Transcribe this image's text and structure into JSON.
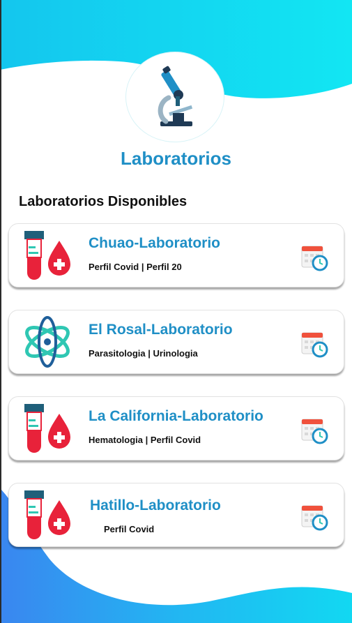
{
  "header": {
    "title": "Laboratorios",
    "logo_icon": "microscope-icon"
  },
  "section": {
    "title": "Laboratorios Disponibles"
  },
  "labs": [
    {
      "name": "Chuao-Laboratorio",
      "tags": "Perfil Covid | Perfil 20",
      "icon": "blood-test-icon",
      "action_icon": "calendar-clock-icon"
    },
    {
      "name": "El Rosal-Laboratorio",
      "tags": "Parasitologia | Urinologia",
      "icon": "atom-icon",
      "action_icon": "calendar-clock-icon"
    },
    {
      "name": "La California-Laboratorio",
      "tags": "Hematologia | Perfil Covid",
      "icon": "blood-test-icon",
      "action_icon": "calendar-clock-icon"
    },
    {
      "name": "Hatillo-Laboratorio",
      "tags": "Perfil Covid",
      "icon": "blood-test-icon",
      "action_icon": "calendar-clock-icon"
    }
  ],
  "colors": {
    "accent": "#1f8fc6",
    "wave_cyan": "#14d9ef",
    "wave_blue": "#3d8cf0",
    "blood_red": "#e8223a",
    "tube_cap": "#1f5f7a",
    "atom_teal": "#2fc7b3"
  }
}
